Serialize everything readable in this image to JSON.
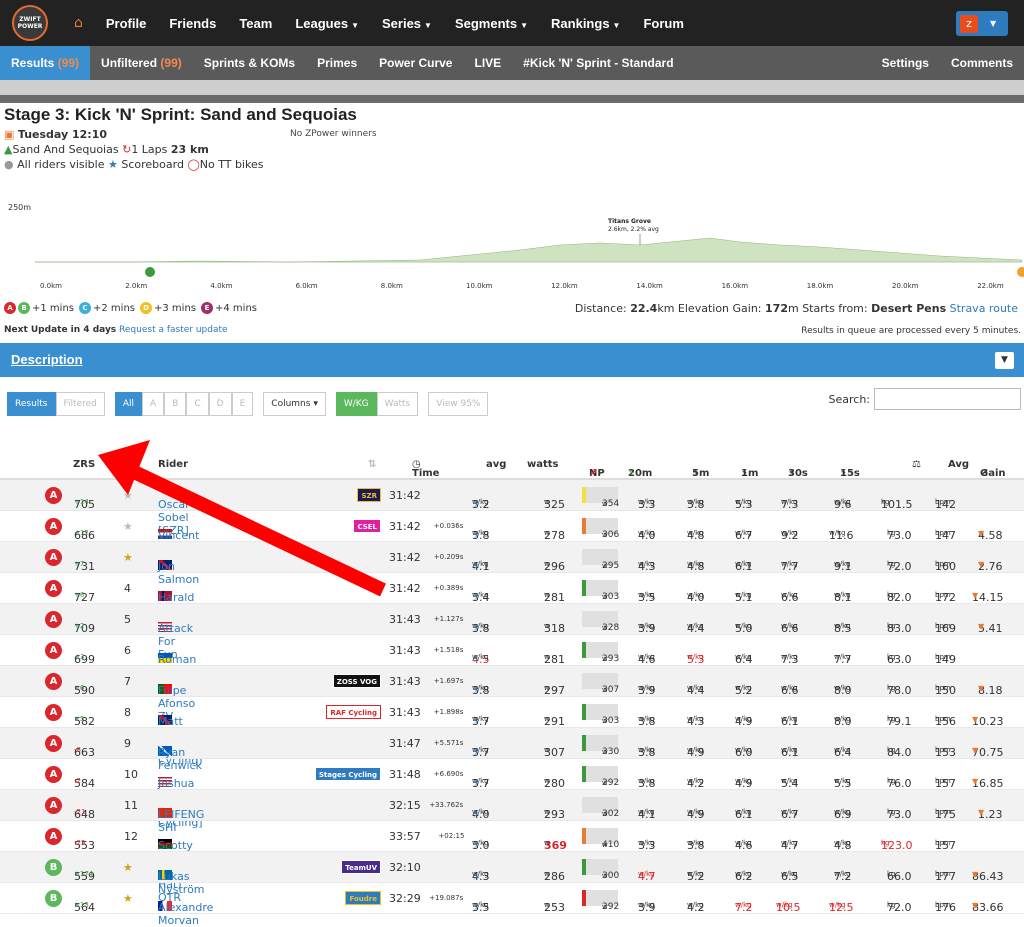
{
  "nav": {
    "logo_text": "ZWIFT POWER",
    "items": [
      "Profile",
      "Friends",
      "Team",
      "Leagues",
      "Series",
      "Segments",
      "Rankings",
      "Forum"
    ],
    "dropdowns": [
      "Leagues",
      "Series",
      "Segments",
      "Rankings"
    ]
  },
  "subnav": {
    "results": "Results",
    "results_count": "(99)",
    "unfiltered": "Unfiltered",
    "unfiltered_count": "(99)",
    "items": [
      "Sprints & KOMs",
      "Primes",
      "Power Curve",
      "LIVE",
      "#Kick 'N' Sprint - Standard"
    ],
    "right": [
      "Settings",
      "Comments"
    ]
  },
  "event": {
    "title": "Stage 3: Kick 'N' Sprint: Sand and Sequoias",
    "date": "Tuesday 12:10",
    "no_zpower": "No ZPower winners",
    "route": "Sand And Sequoias",
    "laps": "1 Laps",
    "distance_km": "23 km",
    "visibility": "All riders visible",
    "scoreboard": "Scoreboard",
    "no_tt": "No TT bikes"
  },
  "elevation": {
    "top_label": "250m",
    "segment": "Titans Grove",
    "segment_info": "2.6km, 2.2% avg",
    "ticks": [
      "0.0km",
      "2.0km",
      "4.0km",
      "6.0km",
      "8.0km",
      "10.0km",
      "12.0km",
      "14.0km",
      "16.0km",
      "18.0km",
      "20.0km",
      "22.0km"
    ]
  },
  "legend": {
    "a": "A",
    "b": "B",
    "b_txt": "+1 mins",
    "c": "C",
    "c_txt": "+2 mins",
    "d": "D",
    "d_txt": "+3 mins",
    "e": "E",
    "e_txt": "+4 mins"
  },
  "info": {
    "distance_label": "Distance:",
    "distance": "22.4",
    "distance_unit": "km",
    "elev_label": "Elevation Gain:",
    "elev": "172",
    "elev_unit": "m",
    "start_label": "Starts from:",
    "start": "Desert Pens",
    "strava": "Strava route"
  },
  "update": {
    "next": "Next Update in 4 days",
    "request": "Request a faster update",
    "queue": "Results in queue are processed every 5 minutes."
  },
  "description": {
    "title": "Description"
  },
  "buttons": {
    "results": "Results",
    "filtered": "Filtered",
    "all": "All",
    "cats": [
      "A",
      "B",
      "C",
      "D",
      "E"
    ],
    "columns": "Columns",
    "wkg": "W/KG",
    "watts": "Watts",
    "view95": "View 95%"
  },
  "search": {
    "label": "Search:",
    "placeholder": ""
  },
  "table": {
    "headers": {
      "zrs": "ZRS",
      "rider": "Rider",
      "time": "Time",
      "avg": "avg",
      "watts": "watts",
      "np": "NP",
      "m20": "20m",
      "m5": "5m",
      "m1": "1m",
      "s30": "30s",
      "s15": "15s",
      "wt": "",
      "hr": "Avg",
      "gain": "Gain"
    },
    "rows": [
      {
        "cat": "A",
        "zrs": "705",
        "zd": "+14",
        "pos": "",
        "flag": "",
        "name": "Oscar Sobel [SZR]",
        "team": "SZR",
        "tc": "#1a1a5e",
        "tf": "#f0c020",
        "time": "31:42",
        "gap": "",
        "avg": "3.2",
        "watts": "325",
        "np": "354",
        "npc": "#f0e040",
        "w20": "3.3",
        "w5": "3.8",
        "w1": "5.3",
        "w30": "7.3",
        "w15": "9.6",
        "wt": "101.5",
        "hr": "142",
        "gain": ""
      },
      {
        "cat": "A",
        "zrs": "686",
        "zd": "+12",
        "pos": "",
        "flag": "nl",
        "name": "Vincent de Bie",
        "team": "CSEL",
        "tc": "#e020a0",
        "tf": "#fff",
        "time": "31:42",
        "gap": "+0.036s",
        "avg": "3.8",
        "watts": "278",
        "np": "306",
        "npc": "#e87a35",
        "w20": "4.0",
        "w5": "4.8",
        "w1": "6.7",
        "w30": "9.2",
        "w15": "11.6",
        "wt": "73.0",
        "hr": "147",
        "gain": "4.58"
      },
      {
        "cat": "A",
        "zrs": "731",
        "zd": "+7",
        "pos": "",
        "flag": "gb",
        "name": "Jon Salmon",
        "team": "",
        "tc": "",
        "tf": "",
        "time": "31:42",
        "gap": "+0.209s",
        "avg": "4.1",
        "watts": "296",
        "np": "295",
        "npc": "#e0e0e0",
        "w20": "4.3",
        "w5": "4.8",
        "w1": "6.1",
        "w30": "7.7",
        "w15": "9.1",
        "wt": "72.0",
        "hr": "160",
        "gain": "2.76"
      },
      {
        "cat": "A",
        "zrs": "727",
        "zd": "+6",
        "pos": "4",
        "flag": "no",
        "name": "Harald Hjorthen [V]",
        "team": "",
        "tc": "#2e7bbf",
        "tf": "#fff",
        "time": "31:42",
        "gap": "+0.389s",
        "avg": "3.4",
        "watts": "281",
        "np": "303",
        "npc": "#3c9a3c",
        "w20": "3.5",
        "w5": "4.0",
        "w1": "5.1",
        "w30": "6.6",
        "w15": "8.1",
        "wt": "82.0",
        "hr": "172",
        "gain": "14.15"
      },
      {
        "cat": "A",
        "zrs": "709",
        "zd": "+2",
        "pos": "5",
        "flag": "us",
        "name": "Attack For Fun",
        "team": "",
        "tc": "",
        "tf": "",
        "time": "31:43",
        "gap": "+1.127s",
        "avg": "3.8",
        "watts": "318",
        "np": "328",
        "npc": "#e0e0e0",
        "w20": "3.9",
        "w5": "4.4",
        "w1": "5.0",
        "w30": "6.6",
        "w15": "8.5",
        "wt": "83.0",
        "hr": "169",
        "gain": "5.41"
      },
      {
        "cat": "A",
        "zrs": "699",
        "zd": "+3",
        "pos": "6",
        "flag": "ua",
        "name": "Roman Bevz",
        "team": "",
        "tc": "",
        "tf": "",
        "time": "31:43",
        "gap": "+1.518s",
        "avg": "4.5",
        "watts": "281",
        "np": "293",
        "npc": "#3c9a3c",
        "w20": "4.6",
        "w5": "5.3",
        "w1": "6.4",
        "w30": "7.3",
        "w15": "7.7",
        "wt": "63.0",
        "hr": "149",
        "gain": ""
      },
      {
        "cat": "A",
        "zrs": "590",
        "zd": "+6",
        "pos": "7",
        "flag": "pt",
        "name": "Filipe Afonso ZV",
        "team": "ZOSS VOG",
        "tc": "#111",
        "tf": "#fff",
        "time": "31:43",
        "gap": "+1.697s",
        "avg": "3.8",
        "watts": "297",
        "np": "307",
        "npc": "#e0e0e0",
        "w20": "3.9",
        "w5": "4.4",
        "w1": "5.2",
        "w30": "6.6",
        "w15": "8.0",
        "wt": "78.0",
        "hr": "150",
        "gain": "8.18"
      },
      {
        "cat": "A",
        "zrs": "582",
        "zd": "+5",
        "pos": "8",
        "flag": "gb",
        "name": "Matt Beauchamp (RAF Cycling)",
        "team": "RAF Cycling",
        "tc": "#fff",
        "tf": "#d9272d",
        "time": "31:43",
        "gap": "+1.898s",
        "avg": "3.7",
        "watts": "291",
        "np": "303",
        "npc": "#3c9a3c",
        "w20": "3.8",
        "w5": "4.3",
        "w1": "4.9",
        "w30": "6.1",
        "w15": "8.0",
        "wt": "79.1",
        "hr": "156",
        "gain": "10.23"
      },
      {
        "cat": "A",
        "zrs": "663",
        "zd": "-8",
        "pos": "9",
        "flag": "sc",
        "name": "Ryan Fenwick",
        "team": "",
        "tc": "",
        "tf": "",
        "time": "31:47",
        "gap": "+5.571s",
        "avg": "3.7",
        "watts": "307",
        "np": "330",
        "npc": "#3c9a3c",
        "w20": "3.8",
        "w5": "4.9",
        "w1": "6.0",
        "w30": "6.1",
        "w15": "6.4",
        "wt": "84.0",
        "hr": "153",
        "gain": "70.75"
      },
      {
        "cat": "A",
        "zrs": "584",
        "zd": "-2",
        "pos": "10",
        "flag": "us",
        "name": "Joshua Sayre [Stages Cycling]",
        "team": "Stages Cycling",
        "tc": "#2e7bbf",
        "tf": "#fff",
        "time": "31:48",
        "gap": "+6.690s",
        "avg": "3.7",
        "watts": "280",
        "np": "292",
        "npc": "#3c9a3c",
        "w20": "3.8",
        "w5": "4.2",
        "w1": "4.9",
        "w30": "5.4",
        "w15": "5.5",
        "wt": "76.0",
        "hr": "157",
        "gain": "16.85"
      },
      {
        "cat": "A",
        "zrs": "648",
        "zd": "-21",
        "pos": "11",
        "flag": "cn",
        "name": "LEIFENG SHI",
        "team": "",
        "tc": "",
        "tf": "",
        "time": "32:15",
        "gap": "+33.762s",
        "avg": "4.0",
        "watts": "293",
        "np": "302",
        "npc": "#e0e0e0",
        "w20": "4.1",
        "w5": "4.9",
        "w1": "6.1",
        "w30": "6.7",
        "w15": "6.9",
        "wt": "73.0",
        "hr": "175",
        "gain": "1.23"
      },
      {
        "cat": "A",
        "zrs": "553",
        "zd": "-25",
        "pos": "12",
        "flag": "ke",
        "name": "Scotty P (Blue Hat) OTR",
        "team": "",
        "tc": "",
        "tf": "",
        "time": "33:57",
        "gap": "+02:15",
        "avg": "3.0",
        "watts": "369",
        "np": "410",
        "npc": "#e87a35",
        "w20": "3.3",
        "w5": "3.8",
        "w1": "4.6",
        "w30": "4.7",
        "w15": "4.8",
        "wt": "123.0",
        "hr": "157",
        "gain": ""
      },
      {
        "cat": "B",
        "zrs": "559",
        "zd": "+174",
        "pos": "",
        "flag": "se",
        "name": "Lukas Nyström",
        "team": "TeamUV",
        "tc": "#4a2a8a",
        "tf": "#fff",
        "time": "32:10",
        "gap": "",
        "avg": "4.3",
        "watts": "286",
        "np": "300",
        "npc": "#3c9a3c",
        "w20": "4.7",
        "w5": "5.2",
        "w1": "6.2",
        "w30": "6.5",
        "w15": "7.2",
        "wt": "66.0",
        "hr": "177",
        "gain": "86.43"
      },
      {
        "cat": "B",
        "zrs": "564",
        "zd": "+13",
        "pos": "",
        "flag": "fr",
        "name": "Alexandre Morvan",
        "team": "Foudre",
        "tc": "#2e7bbf",
        "tf": "#f0c020",
        "time": "32:29",
        "gap": "+19.087s",
        "avg": "3.5",
        "watts": "253",
        "np": "292",
        "npc": "#d9272d",
        "w20": "3.9",
        "w5": "4.2",
        "w1": "7.2",
        "w30": "10.5",
        "w15": "12.5",
        "wt": "72.0",
        "hr": "176",
        "gain": "83.66"
      }
    ]
  },
  "units": {
    "wkg": "w/kg",
    "w": "w",
    "kg": "kg",
    "bpm": "bpm"
  }
}
